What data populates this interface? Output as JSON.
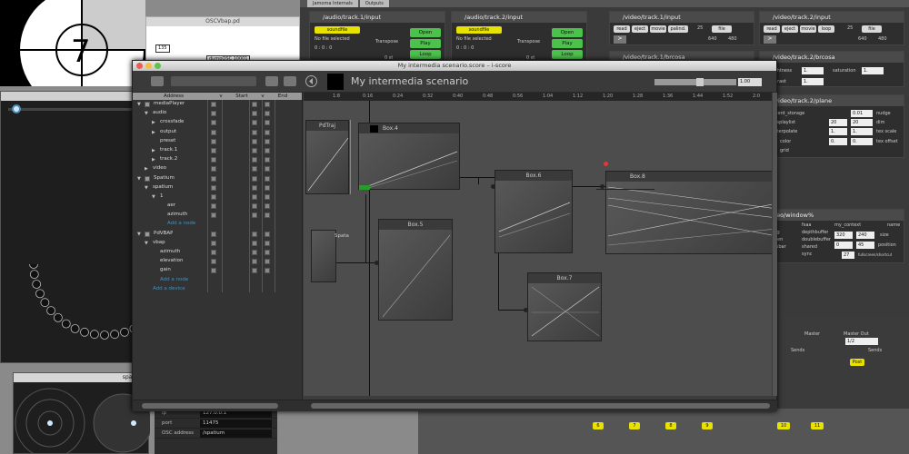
{
  "pd_window": {
    "title": "OSCVbap.pd",
    "boxes": [
      "135",
      "dumpOSC 10001"
    ]
  },
  "spat_window2": {
    "title": "spatium"
  },
  "osc_controls": [
    {
      "key": "ip",
      "value": "127.0.0.1"
    },
    {
      "key": "port",
      "value": "11475"
    },
    {
      "key": "OSC address",
      "value": "/spatium"
    }
  ],
  "jitter": {
    "tabs": [
      "Jamoma Internals",
      "Outputs"
    ],
    "audio_modules": [
      {
        "title": "/audio/track.1/input",
        "dropdown": "soundfile",
        "status": "No file selected",
        "numbers": "0 : 0 : 0",
        "transpose_label": "Transpose",
        "transpose_value": "0 st",
        "open": "Open",
        "play": "Play",
        "loop": "Loop"
      },
      {
        "title": "/audio/track.2/input",
        "dropdown": "soundfile",
        "status": "No file selected",
        "numbers": "0 : 0 : 0",
        "transpose_label": "Transpose",
        "transpose_value": "0 st",
        "open": "Open",
        "play": "Play",
        "loop": "Loop"
      }
    ],
    "video_modules": [
      {
        "title": "/video/track.1/input",
        "buttons": [
          "read",
          "eject",
          "movie",
          "palind."
        ],
        "fps": "25",
        "file": "file",
        "w": "640",
        "h": "480"
      },
      {
        "title": "/video/track.2/input",
        "buttons": [
          "read",
          "eject",
          "movie",
          "loop"
        ],
        "fps": "25",
        "file": "file",
        "w": "640",
        "h": "480"
      }
    ],
    "brcosa1": {
      "title": "/video/track.1/brcosa"
    },
    "brcosa2": {
      "title": "/video/track.2/brcosa",
      "labels": [
        "ightness",
        "saturation",
        "ntrast"
      ],
      "values": [
        "1.",
        "1.",
        "1."
      ]
    },
    "plane": {
      "title": "/video/track.2/plane",
      "rows": [
        {
          "label": "client_storage",
          "value": "0.01",
          "label2": "nudge"
        },
        {
          "label": "displaylist",
          "value": "20",
          "value2": "20",
          "label2": "dim"
        },
        {
          "label": "interpolate",
          "value": "1.",
          "value2": "1.",
          "label2": "tex scale"
        },
        {
          "label": "color",
          "value": "0.",
          "value2": "0.",
          "label2": "tex offset"
        },
        {
          "label": "grid",
          "value": "",
          "value2": "",
          "label2": ""
        }
      ]
    },
    "window": {
      "title": "deo/window%",
      "checks": [
        "fsaa",
        "depthbuffer",
        "doublebuffer",
        "shared",
        "sync"
      ],
      "left_labels": [
        "er",
        "ing",
        "reen",
        "nubar",
        "p"
      ],
      "context": "my_context",
      "name_label": "name",
      "size": [
        "320",
        "240"
      ],
      "size_label": "size",
      "pos": [
        "0",
        "45"
      ],
      "pos_label": "position",
      "fps": "27",
      "fps_label": "fullscreen/shortcut"
    }
  },
  "mixer": {
    "labels": [
      "Master",
      "Master Out",
      "Sends",
      "Sends",
      "Post"
    ],
    "master_select": "1/2",
    "channels": [
      "6",
      "7",
      "8",
      "9",
      "10",
      "11"
    ]
  },
  "main_window": {
    "title": "My intermedia scenario.score – i-score",
    "scenario_title": "My intermedia scenario",
    "zoom": "1.00",
    "tree_headers": [
      "Address",
      "v",
      "Start",
      "v",
      "End"
    ],
    "tree": [
      {
        "label": "mediaPlayer",
        "indent": 14,
        "tri": "▼",
        "cb": true
      },
      {
        "label": "audio",
        "indent": 22,
        "tri": "▼",
        "cb": false
      },
      {
        "label": "crossfade",
        "indent": 30,
        "tri": "▶",
        "cb": false
      },
      {
        "label": "output",
        "indent": 30,
        "tri": "▶",
        "cb": false
      },
      {
        "label": "preset",
        "indent": 30,
        "tri": "",
        "cb": false
      },
      {
        "label": "track.1",
        "indent": 30,
        "tri": "▶",
        "cb": false
      },
      {
        "label": "track.2",
        "indent": 30,
        "tri": "▶",
        "cb": false
      },
      {
        "label": "video",
        "indent": 22,
        "tri": "▶",
        "cb": false
      },
      {
        "label": "Spatium",
        "indent": 14,
        "tri": "▼",
        "cb": true
      },
      {
        "label": "spatium",
        "indent": 22,
        "tri": "▼",
        "cb": false
      },
      {
        "label": "1",
        "indent": 30,
        "tri": "▼",
        "cb": false
      },
      {
        "label": "aer",
        "indent": 38,
        "tri": "",
        "cb": false
      },
      {
        "label": "azimuth",
        "indent": 38,
        "tri": "",
        "cb": false
      },
      {
        "label": "Add a node",
        "indent": 38,
        "tri": "",
        "cb": false,
        "add": true
      },
      {
        "label": "PdVBAP",
        "indent": 14,
        "tri": "▼",
        "cb": true
      },
      {
        "label": "vbap",
        "indent": 22,
        "tri": "▼",
        "cb": false
      },
      {
        "label": "azimuth",
        "indent": 30,
        "tri": "",
        "cb": false
      },
      {
        "label": "elevation",
        "indent": 30,
        "tri": "",
        "cb": false
      },
      {
        "label": "gain",
        "indent": 30,
        "tri": "",
        "cb": false
      },
      {
        "label": "Add a node",
        "indent": 30,
        "tri": "",
        "cb": false,
        "add": true
      },
      {
        "label": "Add a device",
        "indent": 22,
        "tri": "",
        "cb": false,
        "add": true
      }
    ],
    "ruler_ticks": [
      "1:8",
      "0:16",
      "0:24",
      "0:32",
      "0:40",
      "0:48",
      "0:56",
      "1:04",
      "1:12",
      "1:20",
      "1:28",
      "1:36",
      "1:44",
      "1:52",
      "2:0"
    ],
    "boxes": {
      "pdtraj": "PdTraj",
      "box4": "Box.4",
      "box5": "Box.5",
      "box6": "Box.6",
      "box7": "Box.7",
      "box8": "Box.8",
      "spata": "Spata"
    }
  },
  "accent_colors": {
    "yellow": "#e8e200",
    "green": "#4cc24c",
    "red": "#e0383c",
    "blue": "#4a8fb6"
  }
}
